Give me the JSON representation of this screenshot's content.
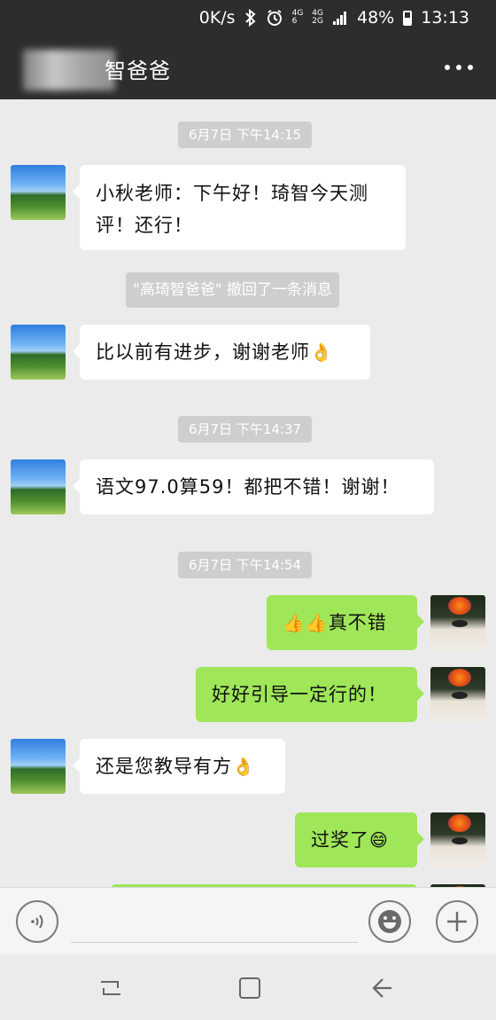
{
  "status_bar": {
    "speed": "0K/s",
    "net1_top": "4G",
    "net1_bottom": "6",
    "net2_top": "4G",
    "net2_bottom": "2G",
    "battery": "48%",
    "time": "13:13"
  },
  "header": {
    "title": "智爸爸"
  },
  "messages": {
    "ts1": "6月7日 下午14:15",
    "m1": "小秋老师：下午好！琦智今天测评！还行！",
    "recall": "\"高琦智爸爸\" 撤回了一条消息",
    "m2": "比以前有进步，谢谢老师",
    "m2_emoji": "👌",
    "ts2": "6月7日 下午14:37",
    "m3": "语文97.0算59！都把不错！谢谢！",
    "ts3": "6月7日 下午14:54",
    "m4_emoji": "👍👍",
    "m4": "真不错",
    "m5": "好好引导一定行的！",
    "m6": "还是您教导有方",
    "m6_emoji": "👌",
    "m7": "过奖了",
    "m7_emoji": "😄"
  }
}
